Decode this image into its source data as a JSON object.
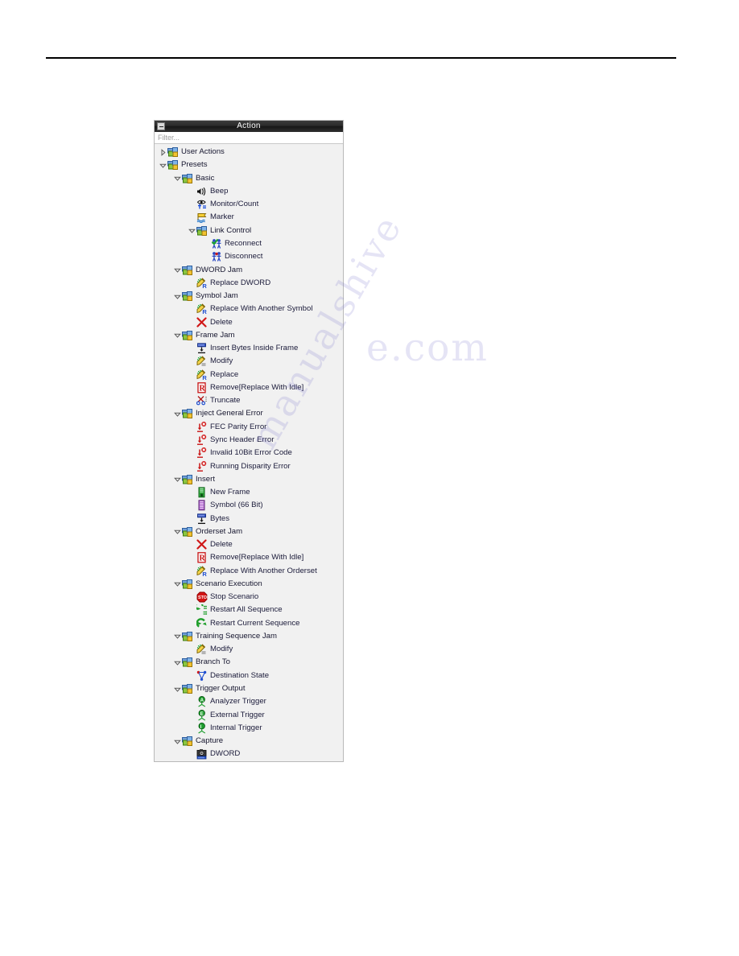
{
  "panel": {
    "title": "Action",
    "collapse_icon": "minimize-icon",
    "filter": {
      "value": "",
      "placeholder": "Filter..."
    },
    "tree": [
      {
        "label": "User Actions",
        "depth": 0,
        "icon": "folder-group-icon",
        "twisty": "collapsed"
      },
      {
        "label": "Presets",
        "depth": 0,
        "icon": "folder-group-icon",
        "twisty": "expanded"
      },
      {
        "label": "Basic",
        "depth": 1,
        "icon": "folder-group-icon",
        "twisty": "expanded"
      },
      {
        "label": "Beep",
        "depth": 2,
        "icon": "speaker-sound-icon",
        "twisty": "none"
      },
      {
        "label": "Monitor/Count",
        "depth": 2,
        "icon": "eye-monitor-icon",
        "twisty": "none"
      },
      {
        "label": "Marker",
        "depth": 2,
        "icon": "marker-flag-icon",
        "twisty": "none"
      },
      {
        "label": "Link Control",
        "depth": 2,
        "icon": "folder-group-icon",
        "twisty": "expanded"
      },
      {
        "label": "Reconnect",
        "depth": 3,
        "icon": "reconnect-icon",
        "twisty": "none"
      },
      {
        "label": "Disconnect",
        "depth": 3,
        "icon": "disconnect-icon",
        "twisty": "none"
      },
      {
        "label": "DWORD Jam",
        "depth": 1,
        "icon": "folder-group-icon",
        "twisty": "expanded"
      },
      {
        "label": "Replace DWORD",
        "depth": 2,
        "icon": "replace-pencil-icon",
        "twisty": "none"
      },
      {
        "label": "Symbol Jam",
        "depth": 1,
        "icon": "folder-group-icon",
        "twisty": "expanded"
      },
      {
        "label": "Replace With Another Symbol",
        "depth": 2,
        "icon": "replace-pencil-icon",
        "twisty": "none"
      },
      {
        "label": "Delete",
        "depth": 2,
        "icon": "delete-x-icon",
        "twisty": "none"
      },
      {
        "label": "Frame Jam",
        "depth": 1,
        "icon": "folder-group-icon",
        "twisty": "expanded"
      },
      {
        "label": "Insert Bytes Inside Frame",
        "depth": 2,
        "icon": "insert-bytes-icon",
        "twisty": "none"
      },
      {
        "label": "Modify",
        "depth": 2,
        "icon": "modify-pencil-icon",
        "twisty": "none"
      },
      {
        "label": "Replace",
        "depth": 2,
        "icon": "replace-pencil-icon",
        "twisty": "none"
      },
      {
        "label": "Remove[Replace With Idle]",
        "depth": 2,
        "icon": "remove-r-icon",
        "twisty": "none"
      },
      {
        "label": "Truncate",
        "depth": 2,
        "icon": "truncate-scissors-icon",
        "twisty": "none"
      },
      {
        "label": "Inject General Error",
        "depth": 1,
        "icon": "folder-group-icon",
        "twisty": "expanded"
      },
      {
        "label": "FEC Parity Error",
        "depth": 2,
        "icon": "error-inject-icon",
        "twisty": "none"
      },
      {
        "label": "Sync Header Error",
        "depth": 2,
        "icon": "error-inject-icon",
        "twisty": "none"
      },
      {
        "label": "Invalid 10Bit Error Code",
        "depth": 2,
        "icon": "error-inject-icon",
        "twisty": "none"
      },
      {
        "label": "Running Disparity Error",
        "depth": 2,
        "icon": "error-inject-icon",
        "twisty": "none"
      },
      {
        "label": "Insert",
        "depth": 1,
        "icon": "folder-group-icon",
        "twisty": "expanded"
      },
      {
        "label": "New Frame",
        "depth": 2,
        "icon": "new-frame-icon",
        "twisty": "none"
      },
      {
        "label": "Symbol (66 Bit)",
        "depth": 2,
        "icon": "symbol-icon",
        "twisty": "none"
      },
      {
        "label": "Bytes",
        "depth": 2,
        "icon": "insert-bytes-icon",
        "twisty": "none"
      },
      {
        "label": "Orderset Jam",
        "depth": 1,
        "icon": "folder-group-icon",
        "twisty": "expanded"
      },
      {
        "label": "Delete",
        "depth": 2,
        "icon": "delete-x-icon",
        "twisty": "none"
      },
      {
        "label": "Remove[Replace With Idle]",
        "depth": 2,
        "icon": "remove-r-icon",
        "twisty": "none"
      },
      {
        "label": "Replace With Another Orderset",
        "depth": 2,
        "icon": "replace-pencil-icon",
        "twisty": "none"
      },
      {
        "label": "Scenario Execution",
        "depth": 1,
        "icon": "folder-group-icon",
        "twisty": "expanded"
      },
      {
        "label": "Stop Scenario",
        "depth": 2,
        "icon": "stop-sign-icon",
        "twisty": "none"
      },
      {
        "label": "Restart All Sequence",
        "depth": 2,
        "icon": "restart-all-icon",
        "twisty": "none"
      },
      {
        "label": "Restart Current Sequence",
        "depth": 2,
        "icon": "restart-current-icon",
        "twisty": "none"
      },
      {
        "label": "Training Sequence Jam",
        "depth": 1,
        "icon": "folder-group-icon",
        "twisty": "expanded"
      },
      {
        "label": "Modify",
        "depth": 2,
        "icon": "modify-pencil-icon",
        "twisty": "none"
      },
      {
        "label": "Branch To",
        "depth": 1,
        "icon": "folder-group-icon",
        "twisty": "expanded"
      },
      {
        "label": "Destination State",
        "depth": 2,
        "icon": "branch-state-icon",
        "twisty": "none"
      },
      {
        "label": "Trigger Output",
        "depth": 1,
        "icon": "folder-group-icon",
        "twisty": "expanded"
      },
      {
        "label": "Analyzer Trigger",
        "depth": 2,
        "icon": "trigger-a-icon",
        "twisty": "none"
      },
      {
        "label": "External Trigger",
        "depth": 2,
        "icon": "trigger-e-icon",
        "twisty": "none"
      },
      {
        "label": "Internal Trigger",
        "depth": 2,
        "icon": "trigger-i-icon",
        "twisty": "none"
      },
      {
        "label": "Capture",
        "depth": 1,
        "icon": "folder-group-icon",
        "twisty": "expanded"
      },
      {
        "label": "DWORD",
        "depth": 2,
        "icon": "capture-camera-icon",
        "twisty": "none"
      }
    ]
  },
  "watermark": {
    "line1": "e.com",
    "line2": "manualshive"
  },
  "colors": {
    "titlebar": "#202020",
    "panel_bg": "#f1f1f1",
    "text": "#1b1b3a",
    "folder_blue": "#4a7ebb",
    "folder_green": "#6fbf3f",
    "error_red": "#cc2222",
    "trigger_green": "#1e9e2e"
  }
}
